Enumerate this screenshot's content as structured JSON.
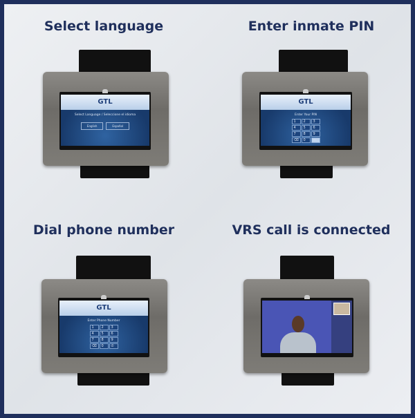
{
  "panels": [
    {
      "title": "Select language",
      "screen": {
        "logo": "GTL",
        "prompt": "Select Language / Seleccione el idioma",
        "buttons": [
          "English",
          "Español"
        ]
      }
    },
    {
      "title": "Enter inmate PIN",
      "screen": {
        "logo": "GTL",
        "prompt": "Enter Your PIN",
        "keys": [
          "1",
          "2",
          "3",
          "4",
          "5",
          "6",
          "7",
          "8",
          "9",
          "⌫",
          "0",
          "—"
        ]
      }
    },
    {
      "title": "Dial phone number",
      "screen": {
        "logo": "GTL",
        "prompt": "Enter Phone Number",
        "keys": [
          "1",
          "2",
          "3",
          "4",
          "5",
          "6",
          "7",
          "8",
          "9",
          "⌫",
          "0",
          "✆"
        ]
      }
    },
    {
      "title": "VRS call is connected"
    }
  ],
  "colors": {
    "title": "#1f2f5c",
    "border": "#1f2f5c",
    "screen": "#183a6b"
  }
}
